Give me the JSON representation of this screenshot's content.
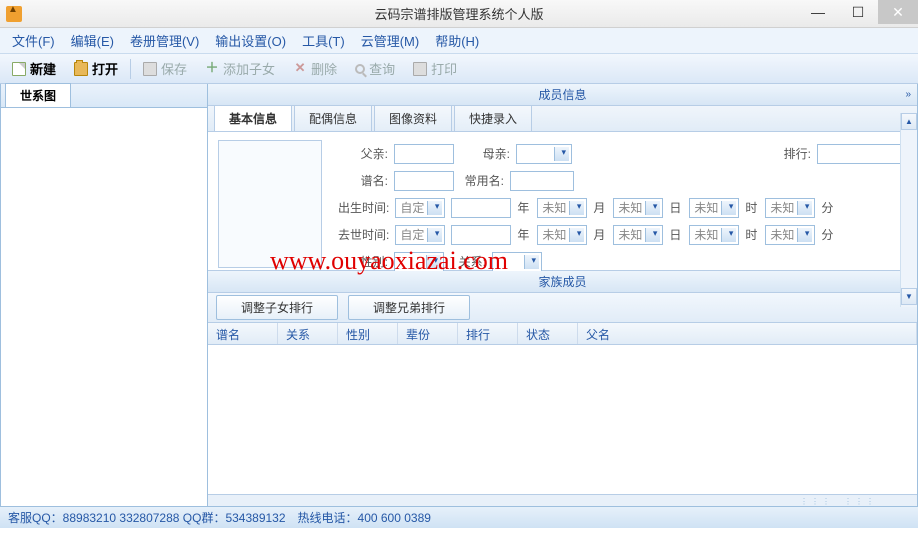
{
  "window": {
    "title": "云码宗谱排版管理系统个人版"
  },
  "menu": {
    "file": "文件(F)",
    "edit": "编辑(E)",
    "volume": "卷册管理(V)",
    "output": "输出设置(O)",
    "tools": "工具(T)",
    "cloud": "云管理(M)",
    "help": "帮助(H)"
  },
  "toolbar": {
    "new": "新建",
    "open": "打开",
    "save": "保存",
    "addChild": "添加子女",
    "delete": "删除",
    "query": "查询",
    "print": "打印"
  },
  "sidebar": {
    "tab": "世系图"
  },
  "main": {
    "head": "成员信息",
    "tabs": {
      "basic": "基本信息",
      "spouse": "配偶信息",
      "image": "图像资料",
      "quick": "快捷录入"
    },
    "form": {
      "father": "父亲:",
      "mother": "母亲:",
      "rank": "排行:",
      "genealogy_name": "谱名:",
      "common_name": "常用名:",
      "birth": "出生时间:",
      "death": "去世时间:",
      "gender": "性别:",
      "relation": "关系:",
      "custom": "自定",
      "unknown": "未知",
      "unit_year": "年",
      "unit_month": "月",
      "unit_day": "日",
      "unit_hour": "时",
      "unit_min": "分"
    },
    "family": {
      "head": "家族成员",
      "btn_child": "调整子女排行",
      "btn_sibling": "调整兄弟排行",
      "cols": {
        "name": "谱名",
        "relation": "关系",
        "gender": "性别",
        "generation": "辈份",
        "rank": "排行",
        "status": "状态",
        "father": "父名"
      }
    }
  },
  "watermark": "www.ouyaoxiazai.com",
  "footer": "客服QQ：88983210 332807288 QQ群：534389132　热线电话：400 600 0389"
}
